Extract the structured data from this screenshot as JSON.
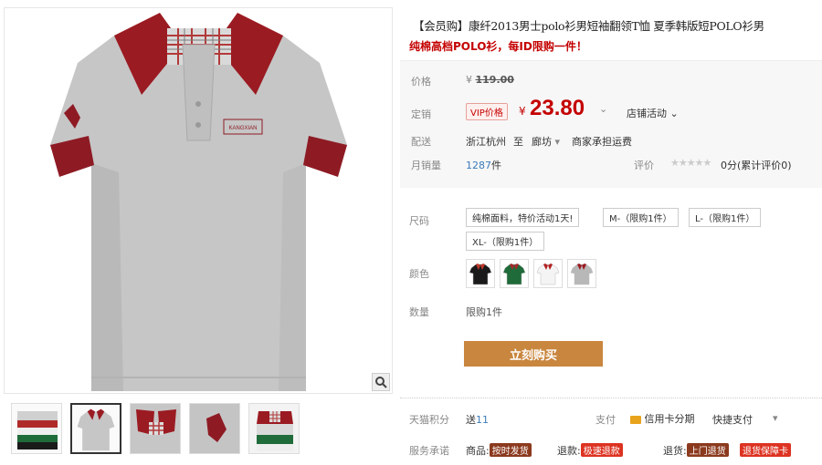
{
  "product": {
    "title": "【会员购】康纤2013男士polo衫男短袖翻领T恤 夏季韩版短POLO衫男",
    "subtitle": "纯棉高档POLO衫，每ID限购一件！"
  },
  "price": {
    "label": "价格",
    "currency": "¥",
    "original": "119.00",
    "promo_label": "定销",
    "vip_badge": "VIP价格",
    "promo_price": "23.80",
    "store_promo": "店铺活动"
  },
  "shipping": {
    "label": "配送",
    "from": "浙江杭州",
    "to_word": "至",
    "to": "廊坊",
    "note": "商家承担运费"
  },
  "sales": {
    "label": "月销量",
    "count": "1287",
    "unit": "件",
    "rating_label": "评价",
    "stars": "★★★★★",
    "rating_text": "0分(累计评价0)"
  },
  "sizes": {
    "label": "尺码",
    "options": [
      "纯棉面料，特价活动1天!",
      "M-（限购1件）",
      "L-（限购1件）",
      "XL-（限购1件）"
    ]
  },
  "colors": {
    "label": "颜色",
    "options": [
      {
        "name": "black",
        "body": "#1a1a1a",
        "collar": "#c0392b"
      },
      {
        "name": "green",
        "body": "#1f6b3a",
        "collar": "#a52a2a"
      },
      {
        "name": "white",
        "body": "#f4f4f4",
        "collar": "#b22222"
      },
      {
        "name": "gray",
        "body": "#b8b8b8",
        "collar": "#9b1b22"
      }
    ]
  },
  "quantity": {
    "label": "数量",
    "value": "限购1件"
  },
  "buy_button": "立刻购买",
  "points": {
    "label": "天猫积分",
    "value_prefix": "送",
    "value": "11",
    "pay_label": "支付",
    "credit_card": "信用卡分期",
    "quick_pay": "快捷支付"
  },
  "service": {
    "label": "服务承诺",
    "product_label": "商品:",
    "product_badge": "按时发货",
    "refund_label": "退款:",
    "refund_badge": "极速退款",
    "return_label": "退货:",
    "return_badge": "上门退货",
    "guarantee_badge": "退货保障卡"
  },
  "colors_theme": {
    "accent": "#c40000",
    "buy": "#c9863e",
    "shirt_gray": "#c8c8c8",
    "collar_red": "#8e1b24"
  }
}
